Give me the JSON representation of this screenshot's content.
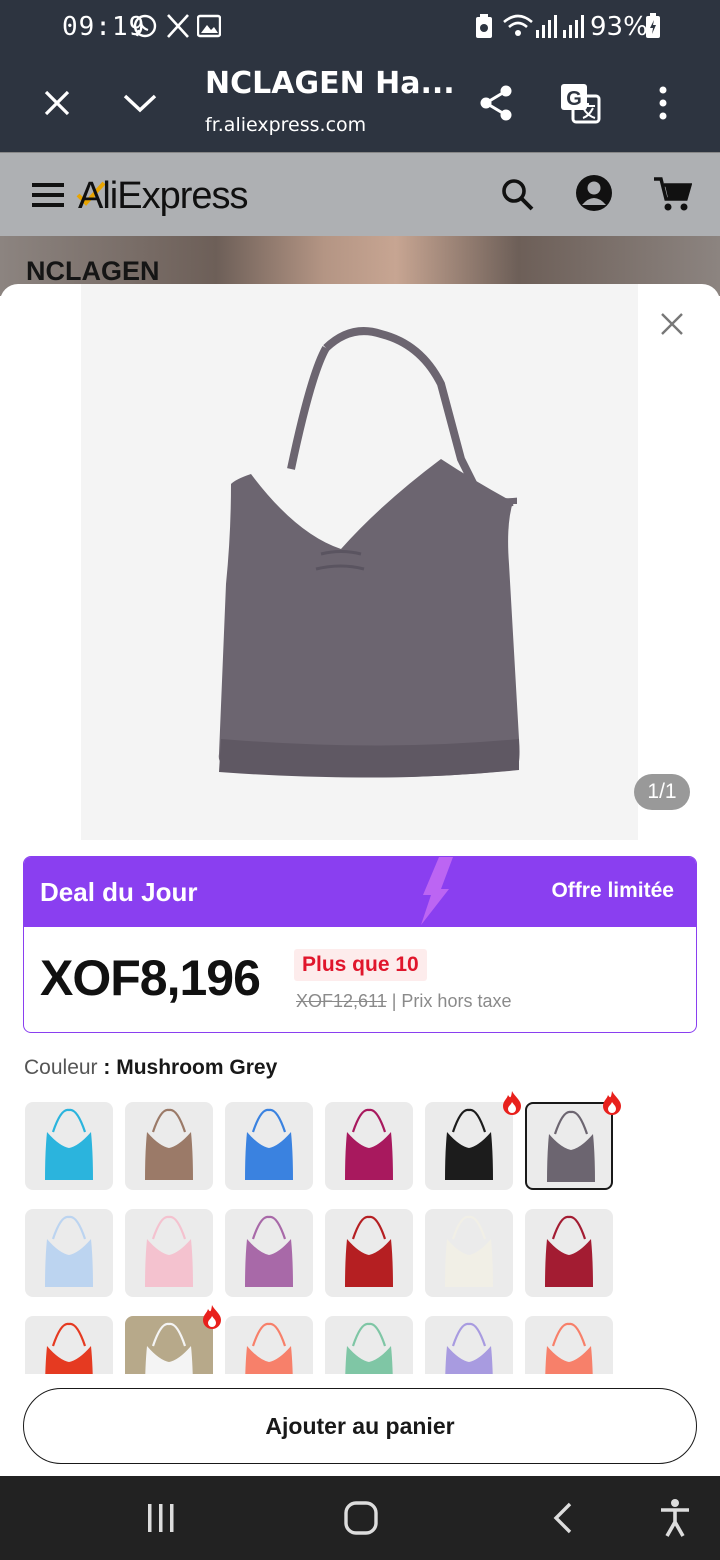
{
  "status_bar": {
    "time": "09:19",
    "battery": "93%",
    "icons": [
      "whatsapp-icon",
      "x-icon",
      "gallery-icon",
      "battery-saver-icon",
      "wifi-icon",
      "signal-icon",
      "signal-icon",
      "battery-icon"
    ]
  },
  "browser": {
    "title": "NCLAGEN Ha...",
    "url": "fr.aliexpress.com",
    "icons": [
      "close-icon",
      "chevron-down-icon",
      "share-icon",
      "translate-icon",
      "more-icon"
    ]
  },
  "site_header": {
    "logo": "AliExpress",
    "icons": [
      "menu-icon",
      "search-icon",
      "account-icon",
      "cart-icon"
    ]
  },
  "background": {
    "brand": "NCLAGEN"
  },
  "product": {
    "image_counter": "1/1",
    "color_hex": "#6c6570"
  },
  "deal": {
    "title": "Deal du Jour",
    "limited": "Offre limitée",
    "price": "XOF8,196",
    "stock": "Plus que 10",
    "old_price": "XOF12,611",
    "tax_note": "| Prix hors taxe",
    "accent": "#8a3ff0"
  },
  "color": {
    "label": "Couleur",
    "sep": " : ",
    "selected": "Mushroom Grey",
    "swatches": [
      {
        "hex": "#2bb4dd",
        "hot": false,
        "selected": false
      },
      {
        "hex": "#9b7a68",
        "hot": false,
        "selected": false
      },
      {
        "hex": "#3a82e0",
        "hot": false,
        "selected": false
      },
      {
        "hex": "#a8195e",
        "hot": false,
        "selected": false
      },
      {
        "hex": "#1c1c1c",
        "hot": true,
        "selected": false
      },
      {
        "hex": "#6c6570",
        "hot": true,
        "selected": true
      },
      {
        "hex": "#bcd4f0",
        "hot": false,
        "selected": false
      },
      {
        "hex": "#f4c2cf",
        "hot": false,
        "selected": false
      },
      {
        "hex": "#a869a8",
        "hot": false,
        "selected": false
      },
      {
        "hex": "#b51f22",
        "hot": false,
        "selected": false
      },
      {
        "hex": "#f1efe6",
        "hot": false,
        "selected": false
      },
      {
        "hex": "#a31c32",
        "hot": false,
        "selected": false
      },
      {
        "hex": "#e53a21",
        "hot": false,
        "selected": false
      },
      {
        "hex": "#f4f4f4",
        "hot": true,
        "selected": false,
        "bg": "#b7a98a"
      },
      {
        "hex": "#f7806a",
        "hot": false,
        "selected": false
      },
      {
        "hex": "#7fc6a5",
        "hot": false,
        "selected": false
      },
      {
        "hex": "#a89be0",
        "hot": false,
        "selected": false
      },
      {
        "hex": "#f7806a",
        "hot": false,
        "selected": false
      }
    ]
  },
  "cta": {
    "add_to_cart": "Ajouter au panier"
  },
  "nav_bar": {
    "icons": [
      "recents-icon",
      "home-icon",
      "back-icon",
      "accessibility-icon"
    ]
  }
}
